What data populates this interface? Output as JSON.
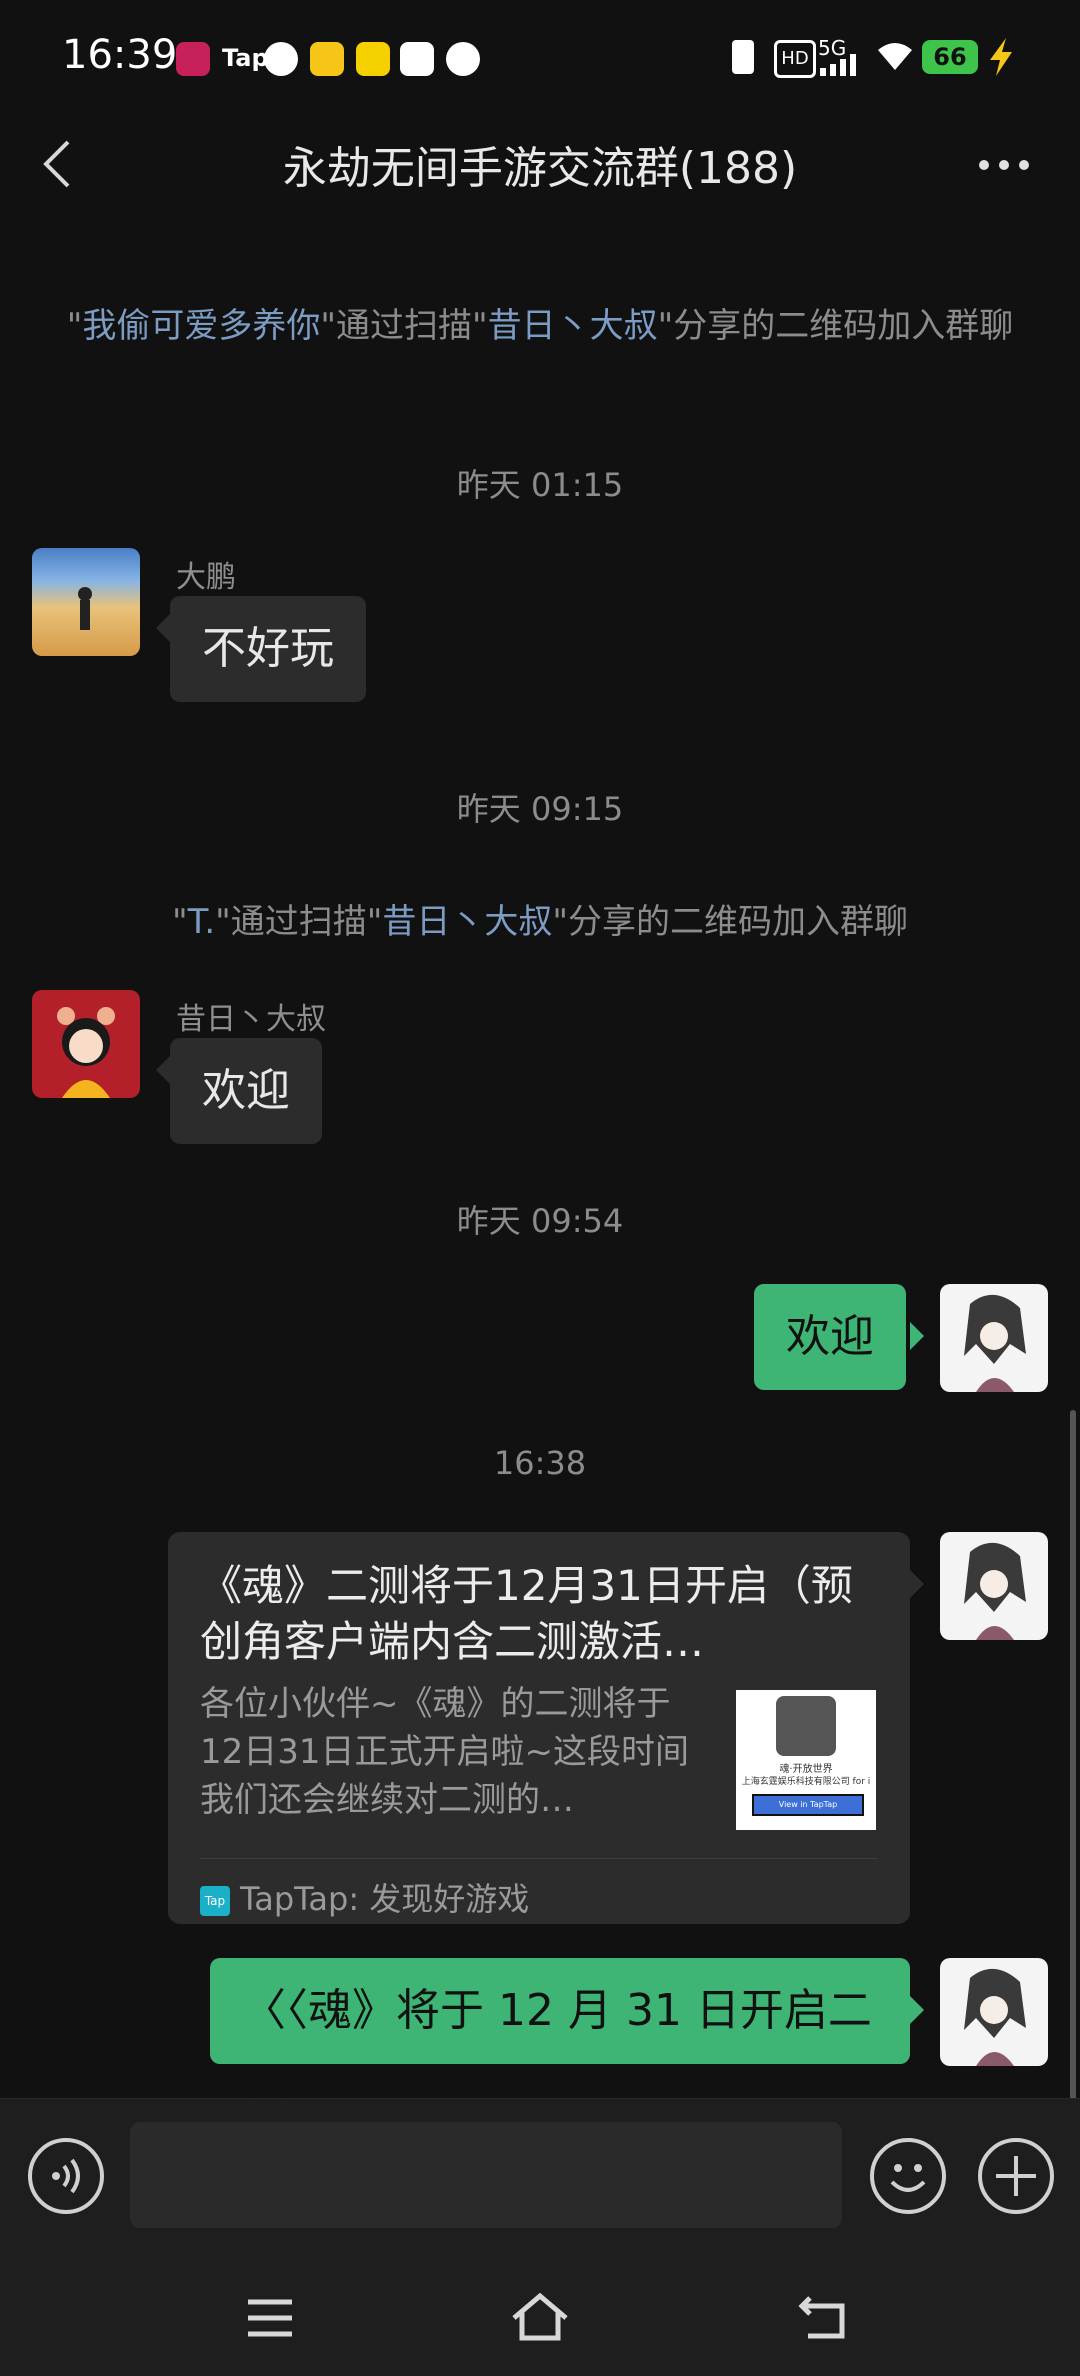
{
  "status": {
    "time": "16:39",
    "network": "5G",
    "hd": "HD",
    "battery": "66",
    "tap_label": "Tap"
  },
  "header": {
    "title": "永劫无间手游交流群(188)"
  },
  "messages": {
    "sys1": {
      "q1": "\"",
      "user": "我偷可爱多养你",
      "q2": "\"通过扫描\"",
      "sharer": "昔日丶大叔",
      "rest": "\"分享的二维码加入群聊"
    },
    "ts1": "昨天 01:15",
    "m1": {
      "name": "大鹏",
      "text": "不好玩"
    },
    "ts2": "昨天 09:15",
    "sys2": {
      "q1": "\"",
      "user": "T.",
      "q2": "\"通过扫描\"",
      "sharer": "昔日丶大叔",
      "rest": "\"分享的二维码加入群聊"
    },
    "m2": {
      "name": "昔日丶大叔",
      "text": "欢迎"
    },
    "ts3": "昨天 09:54",
    "m3": {
      "text": "欢迎"
    },
    "ts4": "16:38",
    "card": {
      "title": "《魂》二测将于12月31日开启（预创角客户端内含二测激活…",
      "desc": "各位小伙伴~《魂》的二测将于12日31日正式开启啦~这段时间我们还会继续对二测的…",
      "thumb_text": "魂·开放世界",
      "thumb_company": "上海玄霆娱乐科技有限公司 for i",
      "thumb_button": "View in TapTap",
      "source_icon": "Tap",
      "source": "TapTap: 发现好游戏"
    },
    "m4": {
      "text": "〈〈魂》将于 12 月 31 日开启二测"
    }
  },
  "colors": {
    "background": "#111111",
    "bubble_in": "#2c2c2c",
    "bubble_out": "#3eb575",
    "link": "#7c9cc4"
  }
}
